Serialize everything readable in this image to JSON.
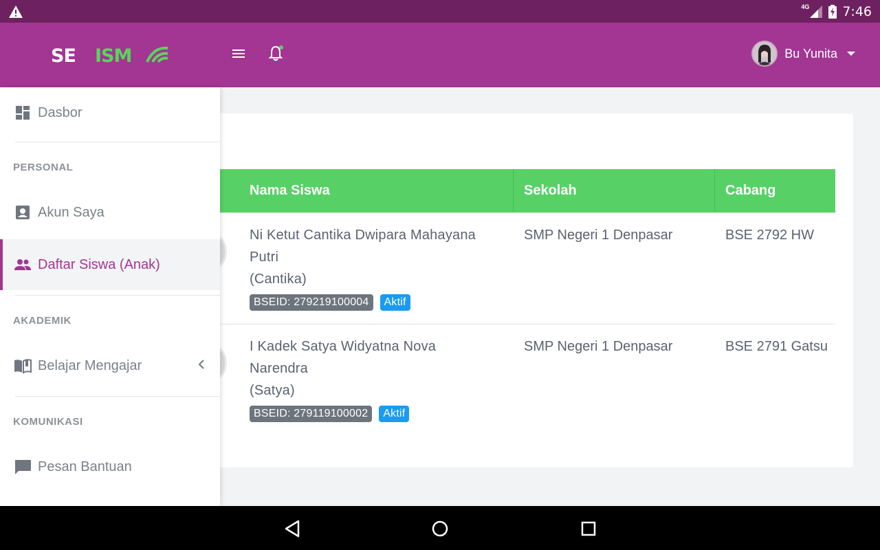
{
  "status_bar": {
    "time": "7:46",
    "network": "4G",
    "icons": [
      "warning-icon",
      "signal-icon",
      "battery-charging-icon"
    ]
  },
  "header": {
    "logo_text": "SEISMO",
    "user_name": "Bu Yunita",
    "icons": [
      "menu-icon",
      "bell-icon",
      "caret-down-icon"
    ]
  },
  "sidebar": {
    "dashboard": "Dasbor",
    "sections": {
      "personal": "PERSONAL",
      "akademik": "AKADEMIK",
      "komunikasi": "KOMUNIKASI"
    },
    "items": {
      "akun": "Akun Saya",
      "daftar_siswa": "Daftar Siswa (Anak)",
      "belajar": "Belajar Mengajar",
      "pesan": "Pesan Bantuan"
    },
    "active_item": "Daftar Siswa (Anak)"
  },
  "table": {
    "columns": {
      "nama": "Nama Siswa",
      "sekolah": "Sekolah",
      "cabang": "Cabang"
    },
    "rows": [
      {
        "name_line1": "Ni Ketut Cantika Dwipara Mahayana",
        "name_line2": "Putri",
        "nickname": "(Cantika)",
        "bseid": "BSEID: 279219100004",
        "status": "Aktif",
        "school": "SMP Negeri 1 Denpasar",
        "branch": "BSE 2792 HW"
      },
      {
        "name_line1": "I Kadek Satya Widyatna Nova",
        "name_line2": "Narendra",
        "nickname": "(Satya)",
        "bseid": "BSEID: 279119100002",
        "status": "Aktif",
        "school": "SMP Negeri 1 Denpasar",
        "branch": "BSE 2791 Gatsu"
      }
    ]
  },
  "colors": {
    "status_bar": "#6e2160",
    "header": "#a33593",
    "table_header": "#57d166",
    "badge_gray": "#6c757d",
    "badge_blue": "#1a9bf0",
    "logo_green": "#5ad45c"
  }
}
